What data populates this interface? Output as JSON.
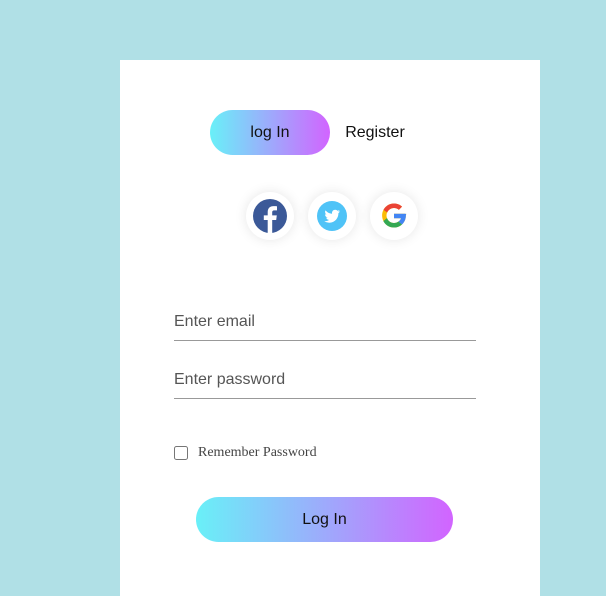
{
  "tabs": {
    "login_label": "log In",
    "register_label": "Register"
  },
  "social": [
    {
      "name": "facebook",
      "icon": "facebook-icon",
      "color": "#3b5998"
    },
    {
      "name": "twitter",
      "icon": "twitter-icon",
      "color": "#4fc3f7"
    },
    {
      "name": "google",
      "icon": "google-icon",
      "color": "#4285f4"
    }
  ],
  "form": {
    "email_placeholder": "Enter email",
    "email_value": "",
    "password_placeholder": "Enter password",
    "password_value": "",
    "remember_label": "Remember Password",
    "remember_checked": false,
    "submit_label": "Log In"
  },
  "colors": {
    "background": "#b0e0e6",
    "card": "#ffffff",
    "gradient_start": "#69f0f8",
    "gradient_end": "#d264ff"
  }
}
